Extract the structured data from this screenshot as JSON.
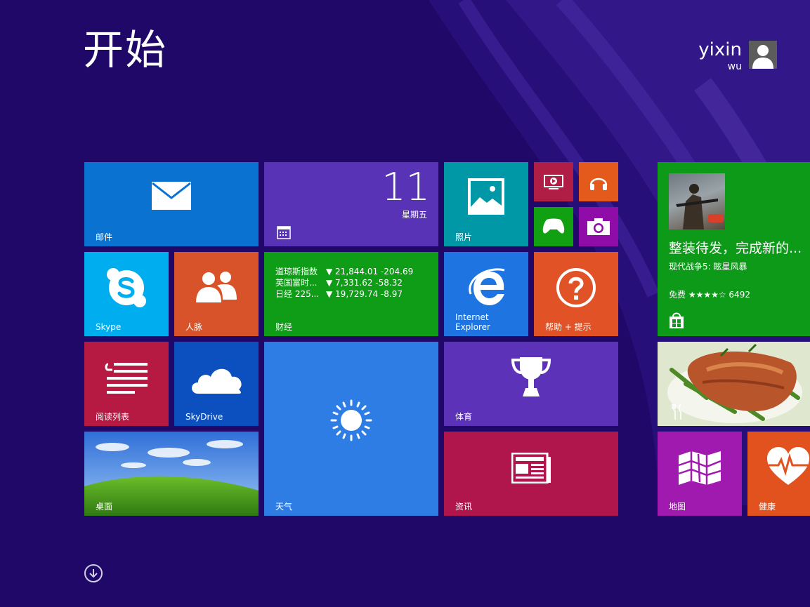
{
  "start": {
    "title": "开始"
  },
  "user": {
    "first_name": "yixin",
    "last_name": "wu"
  },
  "tiles": {
    "mail": {
      "label": "邮件",
      "color": "#0a72d0"
    },
    "calendar": {
      "day": "11",
      "weekday": "星期五",
      "color": "#5833b5"
    },
    "photos": {
      "label": "照片",
      "color": "#0097a7"
    },
    "video": {
      "color": "#b01e45"
    },
    "music": {
      "color": "#e45a1c"
    },
    "games": {
      "color": "#10a012"
    },
    "camera": {
      "color": "#8f0ca8"
    },
    "skype": {
      "label": "Skype",
      "color": "#00adef"
    },
    "people": {
      "label": "人脉",
      "color": "#d9532a"
    },
    "finance": {
      "label": "财经",
      "color": "#0f9c17",
      "rows": [
        {
          "name": "道琼斯指数",
          "value": "▼ 21,844.01 -204.69"
        },
        {
          "name": "英国富时...",
          "value": "▼ 7,331.62 -58.32"
        },
        {
          "name": "日经 225...",
          "value": "▼ 19,729.74 -8.97"
        }
      ]
    },
    "ie": {
      "label_line1": "Internet",
      "label_line2": "Explorer",
      "color": "#1e74e0"
    },
    "help": {
      "label": "帮助 + 提示",
      "color": "#e15227"
    },
    "store": {
      "title": "整装待发，完成新的...",
      "subtitle": "现代战争5: 眩星风暴",
      "rating": "免费 ★★★★☆ 6492",
      "color": "#0e9a19"
    },
    "reading_list": {
      "label": "阅读列表",
      "color": "#b61a43"
    },
    "skydrive": {
      "label": "SkyDrive",
      "color": "#0c4fbe"
    },
    "weather": {
      "label": "天气",
      "color": "#2e7de4"
    },
    "sports": {
      "label": "体育",
      "color": "#5b32b8"
    },
    "food": {
      "color": "#e6ecd6"
    },
    "desktop": {
      "label": "桌面"
    },
    "news": {
      "label": "资讯",
      "color": "#b0164c"
    },
    "maps": {
      "label": "地图",
      "color": "#a01ab0"
    },
    "health": {
      "label": "健康",
      "color": "#e2521f"
    }
  }
}
